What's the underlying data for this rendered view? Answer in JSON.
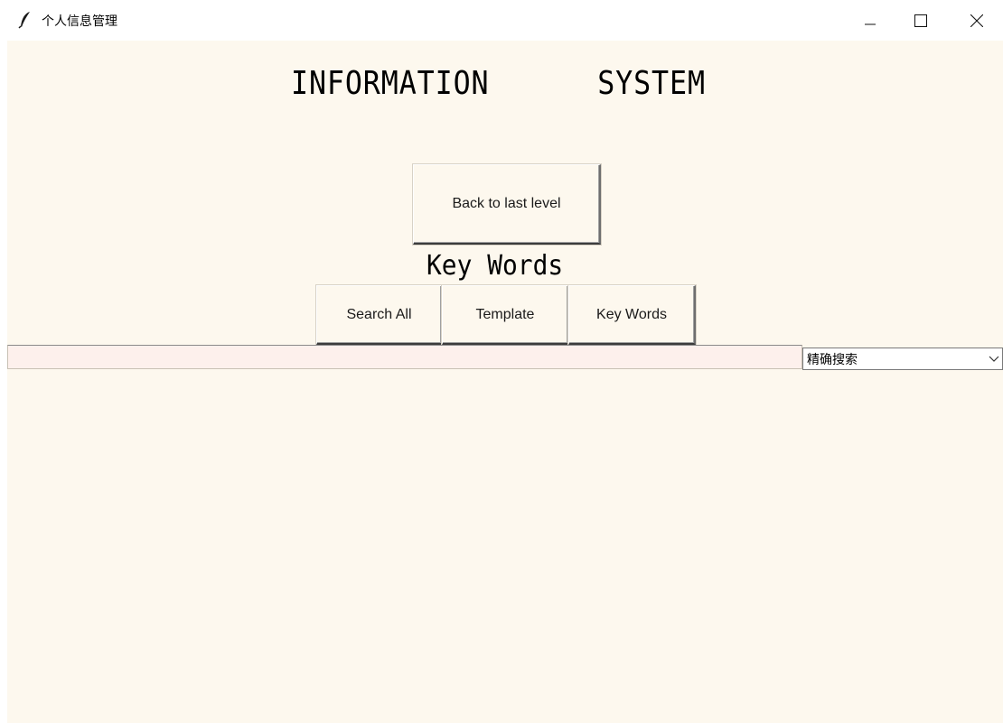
{
  "window": {
    "title": "个人信息管理"
  },
  "header": {
    "title": "INFORMATION      SYSTEM"
  },
  "buttons": {
    "back": "Back to last level",
    "search_all": "Search All",
    "template": "Template",
    "key_words": "Key Words"
  },
  "section": {
    "label": "Key Words"
  },
  "search": {
    "value": "",
    "placeholder": ""
  },
  "mode_select": {
    "selected": "精确搜索"
  },
  "colors": {
    "background": "#fdf8ee",
    "input_background": "#fdf0ec"
  },
  "icons": {
    "app": "feather-icon",
    "minimize": "minimize-icon",
    "maximize": "maximize-icon",
    "close": "close-icon",
    "dropdown": "chevron-down-icon"
  }
}
